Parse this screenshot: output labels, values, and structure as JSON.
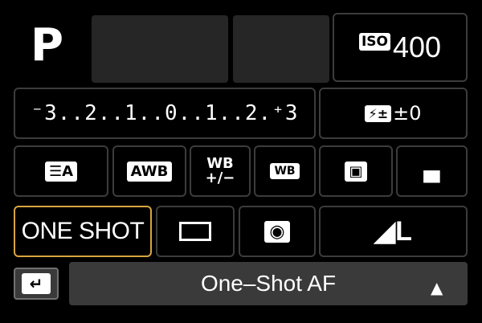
{
  "mode": {
    "label": "P"
  },
  "iso": {
    "badge": "ISO",
    "value": "400"
  },
  "exposure": {
    "scale": "⁻3..2..1..0..1..2.⁺3"
  },
  "flash_comp": {
    "badge": "⚡±",
    "value": "±0"
  },
  "row3": {
    "picture_style": "☰A",
    "awb": "AWB",
    "wb_shift": "WB\n+/−",
    "wb_bracket": "WB",
    "peripheral": "▣",
    "alo": "▄"
  },
  "row4": {
    "af_mode": "ONE SHOT",
    "metering": "◉",
    "quality": "◢L"
  },
  "bottom": {
    "back": "↵",
    "status": "One–Shot AF",
    "chevron": "▲"
  },
  "colors": {
    "background": "#000000",
    "border": "#3c3c3c",
    "selected": "#d9a441",
    "bar": "#3a3a3a"
  }
}
